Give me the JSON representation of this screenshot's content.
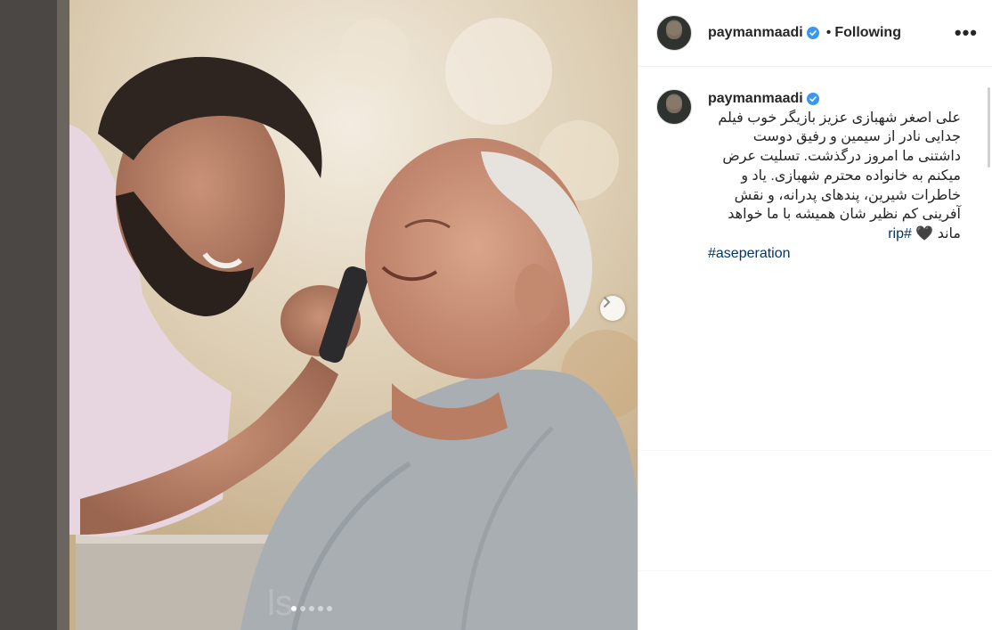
{
  "post": {
    "username": "paymanmaadi",
    "separator": "•",
    "follow_state": "Following",
    "more_label": "•••",
    "carousel": {
      "slide_count": 5,
      "active_index": 0
    }
  },
  "caption": {
    "username": "paymanmaadi",
    "text": "علی اصغر شهبازی عزیز بازیگر خوب فیلم جدایی نادر از سیمین و رفیق دوست داشتنی ما امروز درگذشت. تسلیت عرض میکنم به خانواده محترم شهبازی. یاد و خاطرات شیرین، پندهای پدرانه، و نقش آفرینی کم نظیر شان همیشه با ما خواهد ماند 🖤",
    "hashtag1": "#rip",
    "hashtag2": "#aseperation"
  },
  "colors": {
    "verified": "#3897f0",
    "hashtag": "#00376b",
    "text": "#262626",
    "border": "#efefef"
  },
  "icons": [
    "verified-badge-icon",
    "more-options-icon",
    "chevron-right-icon"
  ]
}
